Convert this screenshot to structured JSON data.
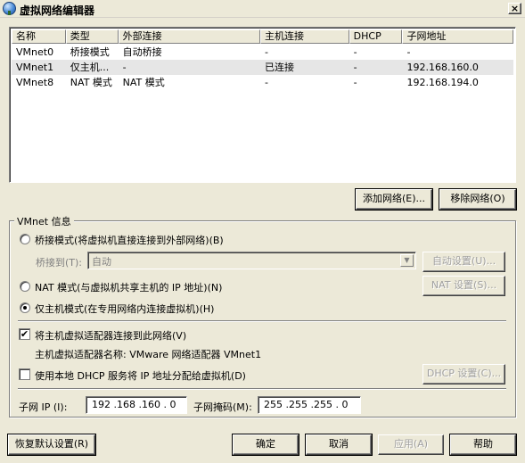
{
  "window": {
    "title": "虚拟网络编辑器",
    "close": "×"
  },
  "table": {
    "columns": [
      "名称",
      "类型",
      "外部连接",
      "主机连接",
      "DHCP",
      "子网地址"
    ],
    "rows": [
      [
        "VMnet0",
        "桥接模式",
        "自动桥接",
        "-",
        "-",
        "-"
      ],
      [
        "VMnet1",
        "仅主机...",
        "-",
        "已连接",
        "-",
        "192.168.160.0"
      ],
      [
        "VMnet8",
        "NAT 模式",
        "NAT 模式",
        "-",
        "-",
        "192.168.194.0"
      ]
    ],
    "selected_row": 1
  },
  "buttons": {
    "add_network": "添加网络(E)...",
    "remove_network": "移除网络(O)",
    "auto_settings": "自动设置(U)...",
    "nat_settings": "NAT 设置(S)...",
    "dhcp_settings": "DHCP 设置(C)...",
    "restore_defaults": "恢复默认设置(R)",
    "ok": "确定",
    "cancel": "取消",
    "apply": "应用(A)",
    "help": "帮助"
  },
  "vmnet_info": {
    "group_label": "VMnet 信息",
    "bridged_label": "桥接模式(将虚拟机直接连接到外部网络)(B)",
    "bridged_to_label": "桥接到(T):",
    "bridged_to_value": "自动",
    "nat_label": "NAT 模式(与虚拟机共享主机的 IP 地址)(N)",
    "hostonly_label": "仅主机模式(在专用网络内连接虚拟机)(H)",
    "connect_adapter_label": "将主机虚拟适配器连接到此网络(V)",
    "adapter_name_label": "主机虚拟适配器名称: VMware 网络适配器 VMnet1",
    "use_dhcp_label": "使用本地 DHCP 服务将 IP 地址分配给虚拟机(D)",
    "subnet_ip_label": "子网 IP (I):",
    "subnet_ip_value": "192 .168 .160 .  0",
    "subnet_mask_label": "子网掩码(M):",
    "subnet_mask_value": "255 .255 .255 .  0",
    "check_mark": "✔"
  }
}
